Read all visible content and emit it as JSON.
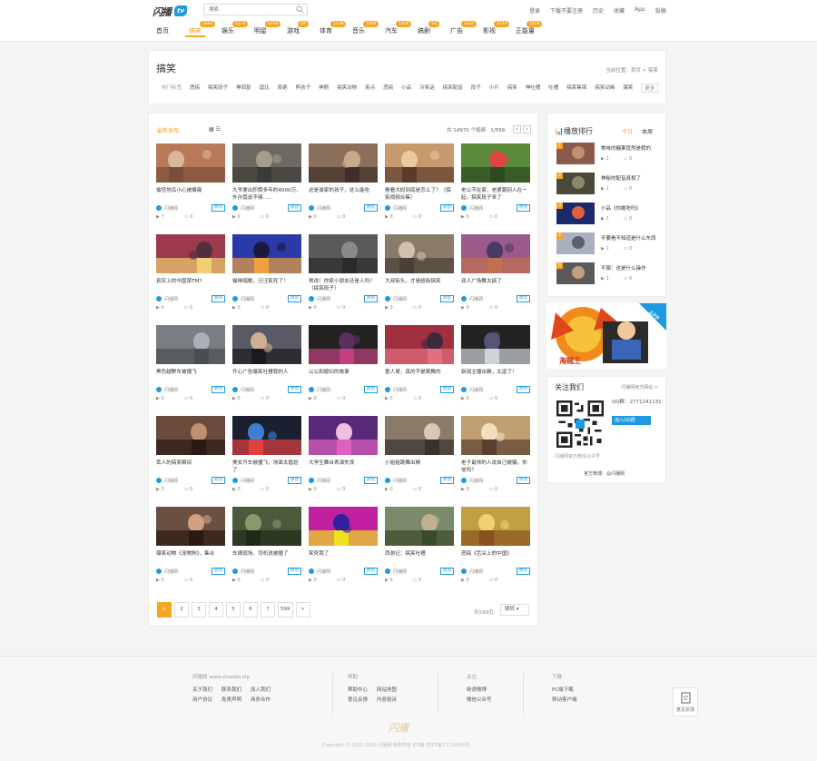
{
  "brand": {
    "logo_text": "闪播",
    "logo_badge": "tv",
    "accent": "#f5a623",
    "blue": "#1e9ae0"
  },
  "search": {
    "placeholder": "搜索",
    "icon": "search-icon"
  },
  "toplinks": [
    "登录",
    "下载不要注册",
    "历史",
    "收藏",
    "App",
    "投稿"
  ],
  "nav": [
    {
      "label": "首页",
      "badge": ""
    },
    {
      "label": "搞笑",
      "badge": "1881"
    },
    {
      "label": "娱乐",
      "badge": "1173"
    },
    {
      "label": "明星",
      "badge": "1456"
    },
    {
      "label": "游戏",
      "badge": "18"
    },
    {
      "label": "体育",
      "badge": "1118"
    },
    {
      "label": "音乐",
      "badge": "1456"
    },
    {
      "label": "汽车",
      "badge": "1456"
    },
    {
      "label": "搞剧",
      "badge": "16"
    },
    {
      "label": "广告",
      "badge": "1131"
    },
    {
      "label": "影视",
      "badge": "1774"
    },
    {
      "label": "正能量",
      "badge": "1426"
    }
  ],
  "category": {
    "title": "搞笑",
    "location": "当前位置：首页 > 搞笑",
    "tag_label": "热门标签",
    "tags": [
      "恶搞",
      "搞笑段子",
      "神回复",
      "逗比",
      "奇葩",
      "熊孩子",
      "神剧",
      "搞笑动物",
      "笑点",
      "恶搞",
      "小品",
      "冷笑话",
      "搞笑配音",
      "段子",
      "小片",
      "搞笑",
      "神吐槽",
      "吐槽",
      "搞笑集锦",
      "搞笑动画",
      "爆笑",
      "更多"
    ]
  },
  "main": {
    "sort": "最新发布",
    "total": "共 14970 个视频",
    "page_of": "1/599",
    "videos": [
      {
        "title": "偷挖地瓜小心被揍扁",
        "author": "闪播网",
        "tag": "原创",
        "views": "7",
        "comments": "0"
      },
      {
        "title": "大爷拿出积攒多年的4000万，外孙竟说不够……",
        "author": "闪播网",
        "tag": "原创",
        "views": "0",
        "comments": "0"
      },
      {
        "title": "这是谁家的孩子，这么能吃",
        "author": "闪播网",
        "tag": "原创",
        "views": "0",
        "comments": "0"
      },
      {
        "title": "看看大妈到底是怎么了？（搞笑视频合集）",
        "author": "闪播网",
        "tag": "原创",
        "views": "0",
        "comments": "0"
      },
      {
        "title": "老公不在家，老婆跟别人在一起，搞笑段子来了",
        "author": "闪播网",
        "tag": "原创",
        "views": "0",
        "comments": "0"
      },
      {
        "title": "真实上的中国菜TM?",
        "author": "闪播网",
        "tag": "原创",
        "views": "0",
        "comments": "0"
      },
      {
        "title": "猫咪唱歌，汪汪笑死了！",
        "author": "闪播网",
        "tag": "原创",
        "views": "0",
        "comments": "0"
      },
      {
        "title": "男孩！你家小朋友还是人吗？（搞笑段子）",
        "author": "闪播网",
        "tag": "原创",
        "views": "0",
        "comments": "0"
      },
      {
        "title": "大叔街头，才是超级搞笑",
        "author": "闪播网",
        "tag": "原创",
        "views": "0",
        "comments": "0"
      },
      {
        "title": "双人广场舞太搞了",
        "author": "闪播网",
        "tag": "原创",
        "views": "0",
        "comments": "0"
      },
      {
        "title": "黑色越野车被撞飞",
        "author": "闪播网",
        "tag": "原创",
        "views": "0",
        "comments": "0"
      },
      {
        "title": "开心广告爆笑吐槽我的人",
        "author": "闪播网",
        "tag": "原创",
        "views": "0",
        "comments": "0"
      },
      {
        "title": "公公和媳妇的故事",
        "author": "闪播网",
        "tag": "原创",
        "views": "0",
        "comments": "0"
      },
      {
        "title": "童人哥，真的不是跳舞的",
        "author": "闪播网",
        "tag": "原创",
        "views": "0",
        "comments": "0"
      },
      {
        "title": "新闻主播出糗，太逗了！",
        "author": "闪播网",
        "tag": "原创",
        "views": "0",
        "comments": "0"
      },
      {
        "title": "丢人的搞笑瞬间",
        "author": "闪播网",
        "tag": "原创",
        "views": "0",
        "comments": "0"
      },
      {
        "title": "美女开车被撞飞，场面太尴尬了",
        "author": "闪播网",
        "tag": "原创",
        "views": "0",
        "comments": "0"
      },
      {
        "title": "大学生舞台表演失误",
        "author": "闪播网",
        "tag": "原创",
        "views": "0",
        "comments": "0"
      },
      {
        "title": "小姐姐跳舞出糗",
        "author": "闪播网",
        "tag": "原创",
        "views": "0",
        "comments": "0"
      },
      {
        "title": "老子最帅的人说自己被骗，你信吗？",
        "author": "闪播网",
        "tag": "原创",
        "views": "0",
        "comments": "0"
      },
      {
        "title": "爆笑动物《宠物狗》，集合",
        "author": "闪播网",
        "tag": "原创",
        "views": "0",
        "comments": "0"
      },
      {
        "title": "车祸现场，司机说被撞了",
        "author": "闪播网",
        "tag": "原创",
        "views": "0",
        "comments": "0"
      },
      {
        "title": "笑死我了",
        "author": "闪播网",
        "tag": "原创",
        "views": "0",
        "comments": "0"
      },
      {
        "title": "西游记：搞笑吐槽",
        "author": "闪播网",
        "tag": "原创",
        "views": "0",
        "comments": "0"
      },
      {
        "title": "恶搞《舌尖上的中国》",
        "author": "闪播网",
        "tag": "原创",
        "views": "0",
        "comments": "0"
      }
    ],
    "pages": [
      "1",
      "2",
      "3",
      "4",
      "5",
      "6",
      "7",
      "599",
      ">"
    ],
    "page_info": "共599页,",
    "page_select": "跳转"
  },
  "rank": {
    "title": "播放排行",
    "tabs": [
      "今日",
      "本周"
    ],
    "items": [
      {
        "num": "1",
        "title": "美味的糖果竟然是假的",
        "views": "2",
        "comments": "0"
      },
      {
        "num": "2",
        "title": "神秘的配音真相了",
        "views": "1",
        "comments": "0"
      },
      {
        "num": "3",
        "title": "小品《你敢吃吗》",
        "views": "1",
        "comments": "0"
      },
      {
        "num": "4",
        "title": "不要看不知道是什么东西",
        "views": "1",
        "comments": "0"
      },
      {
        "num": "5",
        "title": "不服：这是什么操作",
        "views": "1",
        "comments": "0"
      }
    ]
  },
  "ad": {
    "app_label": "APP",
    "title": "海贼王"
  },
  "follow": {
    "title": "关注我们",
    "link": "闪播网官方网站 >",
    "qq_label": "QQ群：2771141131",
    "qq_btn": "加入QQ群",
    "caption": "闪播网官方微信公众号",
    "weibo": "官方微博：@闪播网"
  },
  "footer": {
    "col1_head": "闪播网 www.shanbo.vip",
    "col1": [
      [
        "关于我们",
        "联系我们",
        "加入我们"
      ],
      [
        "用户协议",
        "免责声明",
        "商务合作"
      ]
    ],
    "col2_head": "帮助",
    "col2": [
      [
        "帮助中心",
        "网站地图"
      ],
      [
        "意见反馈",
        "内容投诉"
      ]
    ],
    "col3_head": "关注",
    "col3": [
      [
        "新浪微博"
      ],
      [
        "微信公众号"
      ]
    ],
    "col4_head": "下载",
    "col4": [
      [
        "PC端下载"
      ],
      [
        "移动客户端"
      ]
    ],
    "logo_text": "闪播",
    "copyright": "Copyright © 2016-2019 闪播网 版权所有 ICP备 粤ICP备17114455号",
    "feedback": "意见反馈"
  }
}
